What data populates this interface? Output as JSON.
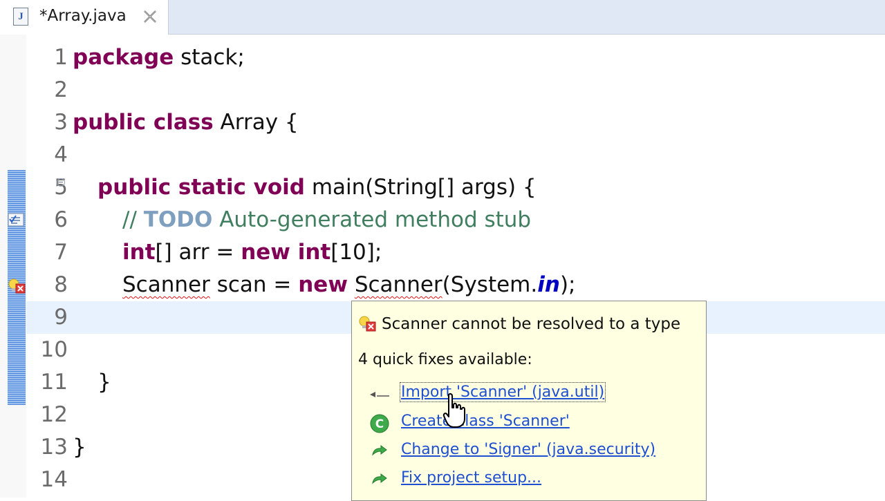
{
  "tab": {
    "title": "*Array.java",
    "icon_letter": "J"
  },
  "lines": [
    {
      "n": "1"
    },
    {
      "n": "2"
    },
    {
      "n": "3"
    },
    {
      "n": "4"
    },
    {
      "n": "5"
    },
    {
      "n": "6"
    },
    {
      "n": "7"
    },
    {
      "n": "8"
    },
    {
      "n": "9"
    },
    {
      "n": "10"
    },
    {
      "n": "11"
    },
    {
      "n": "12"
    },
    {
      "n": "13"
    },
    {
      "n": "14"
    }
  ],
  "code": {
    "l1_kw": "package",
    "l1_rest": " stack;",
    "l3_kw": "public class",
    "l3_rest": " Array {",
    "l5_kw": "public static void",
    "l5_rest": " main(String[] args) {",
    "l6_comment": "// ",
    "l6_todo": "TODO",
    "l6_rest": " Auto-generated method stub",
    "l7_kw1": "int",
    "l7_mid": "[] arr = ",
    "l7_kw2": "new int",
    "l7_rest": "[10];",
    "l8_type": "Scanner",
    "l8_mid": " scan = ",
    "l8_kw": "new",
    "l8_sp": " ",
    "l8_type2": "Scanner",
    "l8_call": "(System.",
    "l8_field": "in",
    "l8_end": ");",
    "l11": "}",
    "l13": "}"
  },
  "popup": {
    "title": "Scanner cannot be resolved to a type",
    "subtitle": "4 quick fixes available:",
    "fixes": [
      {
        "label": "Import 'Scanner' (java.util)",
        "icon": "import-icon"
      },
      {
        "label": "Create class 'Scanner'",
        "icon": "create-class-icon"
      },
      {
        "label": "Change to 'Signer' (java.security)",
        "icon": "change-arrow-icon"
      },
      {
        "label": "Fix project setup...",
        "icon": "change-arrow-icon"
      }
    ]
  },
  "colors": {
    "keyword": "#7f0055",
    "comment": "#3f7f5f",
    "todo": "#7f9fbf",
    "field": "#0000c0",
    "link": "#1f4fd1",
    "popup_bg": "#ffffe1",
    "error": "#e01010"
  }
}
